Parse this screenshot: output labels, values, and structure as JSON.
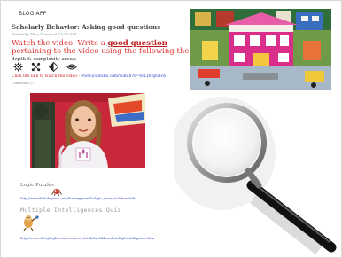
{
  "app": {
    "name": "BLOG APP"
  },
  "post": {
    "title": "Scholarly Behavior: Asking good questions",
    "byline": "Posted by Thea Turner at 11/1/2014",
    "instruction_prefix": "Watch the video. Write a ",
    "instruction_highlight": "good question",
    "instruction_suffix": " pertaining to the video using the following the",
    "depth_label": "depth & complexity areas:",
    "link_prefix": "Click the link to watch the video - ",
    "link_url": "www.youtube.com/watch?v=4dLt0BjtdHA",
    "comments_label": "Comments (7)"
  },
  "resources": {
    "logic_puzzles_label": "Logic Puzzles",
    "logic_puzzles_url": "http://www.thekidsgroup.com/theveryguerrilla/logic_games/solutionskids",
    "quiz_title": "Multiple Intelligences Quiz",
    "quiz_url": "http://www.edu.iqbright.com/resources_for_kids/childhood_multipleintelligences.htm"
  },
  "icons": [
    "details-icon",
    "patterns-icon",
    "ethics-icon",
    "language-icon"
  ],
  "colors": {
    "instruction": "#e03333",
    "link": "#3344cc",
    "photo_bg": "#c8283a",
    "lego_bg": "#5f8f3e"
  }
}
